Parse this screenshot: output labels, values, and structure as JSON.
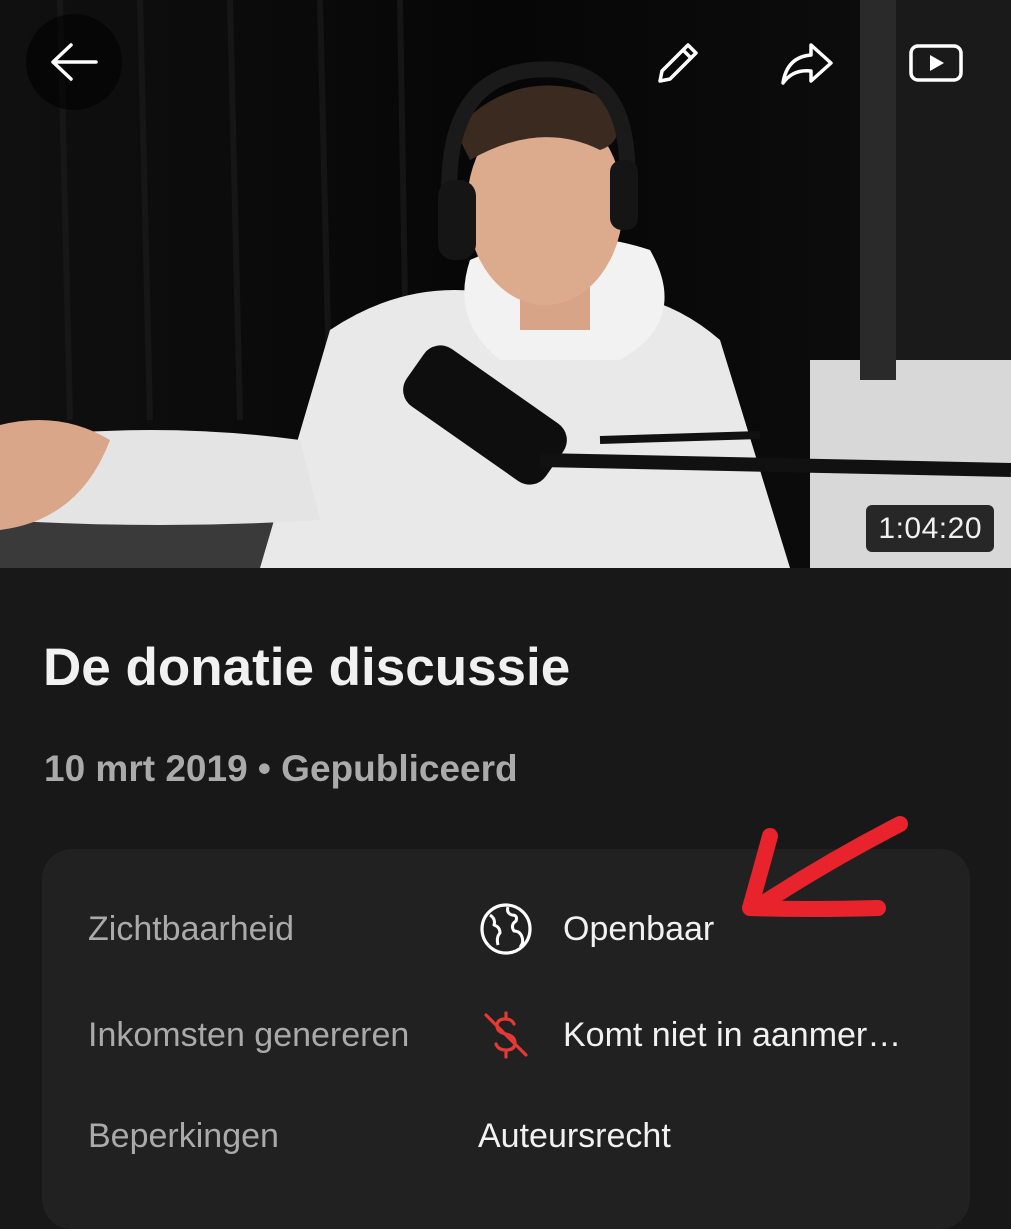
{
  "video": {
    "duration": "1:04:20"
  },
  "header": {
    "back_icon": "arrow-left-icon",
    "edit_icon": "pencil-icon",
    "share_icon": "share-arrow-icon",
    "youtube_icon": "youtube-play-icon"
  },
  "details": {
    "title": "De donatie discussie",
    "meta": "10 mrt 2019 • Gepubliceerd"
  },
  "settings": {
    "rows": [
      {
        "label": "Zichtbaarheid",
        "value": "Openbaar",
        "icon": "globe-icon"
      },
      {
        "label": "Inkomsten genereren",
        "value": "Komt niet in aanmer…",
        "icon": "no-monetization-icon",
        "icon_color": "#e53935"
      },
      {
        "label": "Beperkingen",
        "value": "Auteursrecht"
      }
    ]
  },
  "colors": {
    "background": "#181818",
    "card": "#212121",
    "primary_text": "#f1f1f1",
    "secondary_text": "#aaaaaa",
    "annotation_arrow": "#e8232b"
  }
}
